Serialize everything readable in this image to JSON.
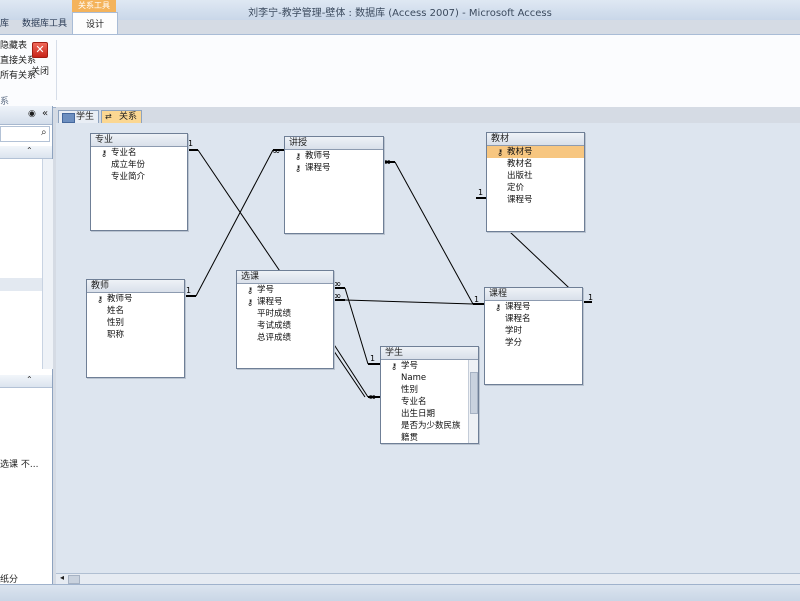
{
  "window": {
    "title": "刘李宁-教学管理-壁体 : 数据库 (Access 2007)  -  Microsoft Access"
  },
  "ribbon": {
    "context_tab_header": "关系工具",
    "tabs": {
      "partial": "库",
      "db_tools": "数据库工具",
      "design": "设计"
    },
    "left_items": [
      "隐藏表",
      "直接关系",
      "所有关系"
    ],
    "close_label": "关闭",
    "group_label": "系"
  },
  "nav": {
    "item_text": "选课 不...",
    "bottom_item": "纸分"
  },
  "doc_tabs": [
    {
      "label": "学生"
    },
    {
      "label": "关系"
    }
  ],
  "tables": {
    "zhuanye": {
      "title": "专业",
      "fields": [
        "专业名",
        "成立年份",
        "专业简介"
      ]
    },
    "jiangshou": {
      "title": "讲授",
      "fields": [
        "教师号",
        "课程号"
      ]
    },
    "jiaocai": {
      "title": "教材",
      "fields": [
        "教材号",
        "教材名",
        "出版社",
        "定价",
        "课程号"
      ]
    },
    "jiaoshi": {
      "title": "教师",
      "fields": [
        "教师号",
        "姓名",
        "性别",
        "职称"
      ]
    },
    "xuanke": {
      "title": "选课",
      "fields": [
        "学号",
        "课程号",
        "平时成绩",
        "考试成绩",
        "总评成绩"
      ]
    },
    "kecheng": {
      "title": "课程",
      "fields": [
        "课程号",
        "课程名",
        "学时",
        "学分"
      ]
    },
    "xuesheng": {
      "title": "学生",
      "fields": [
        "学号",
        "Name",
        "性别",
        "专业名",
        "出生日期",
        "是否为少数民族",
        "籍贯"
      ]
    }
  },
  "relationship_labels": {
    "one": "1",
    "many": "∞"
  },
  "colors": {
    "selected_field": "#f7c680",
    "canvas": "#dde5ef",
    "accent": "#f4b35b"
  }
}
